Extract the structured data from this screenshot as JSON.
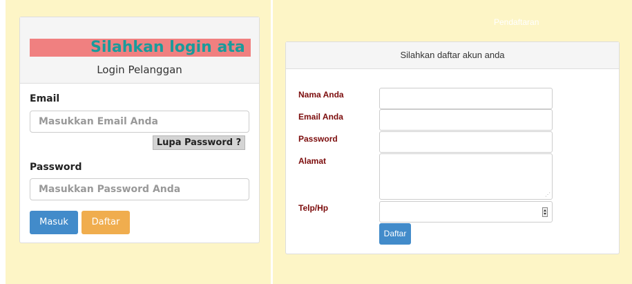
{
  "login": {
    "marquee_text": "Silahkan login ata",
    "title": "Login Pelanggan",
    "email_label": "Email",
    "email_placeholder": "Masukkan Email Anda",
    "forgot_label": "Lupa Password ?",
    "password_label": "Password",
    "password_placeholder": "Masukkan Password Anda",
    "masuk_label": "Masuk",
    "daftar_label": "Daftar"
  },
  "register": {
    "faint_title": "Pendaftaran",
    "heading": "Silahkan daftar akun anda",
    "labels": {
      "nama": "Nama Anda",
      "email": "Email Anda",
      "password": "Password",
      "alamat": "Alamat",
      "telp": "Telp/Hp"
    },
    "submit_label": "Daftar"
  },
  "colors": {
    "panel_background": "#fdf5c6",
    "marquee_background": "#f08080",
    "marquee_text": "#1a9b9b",
    "primary_button": "#428bca",
    "warning_button": "#f0ad4e",
    "register_label": "#7b0b0b"
  }
}
